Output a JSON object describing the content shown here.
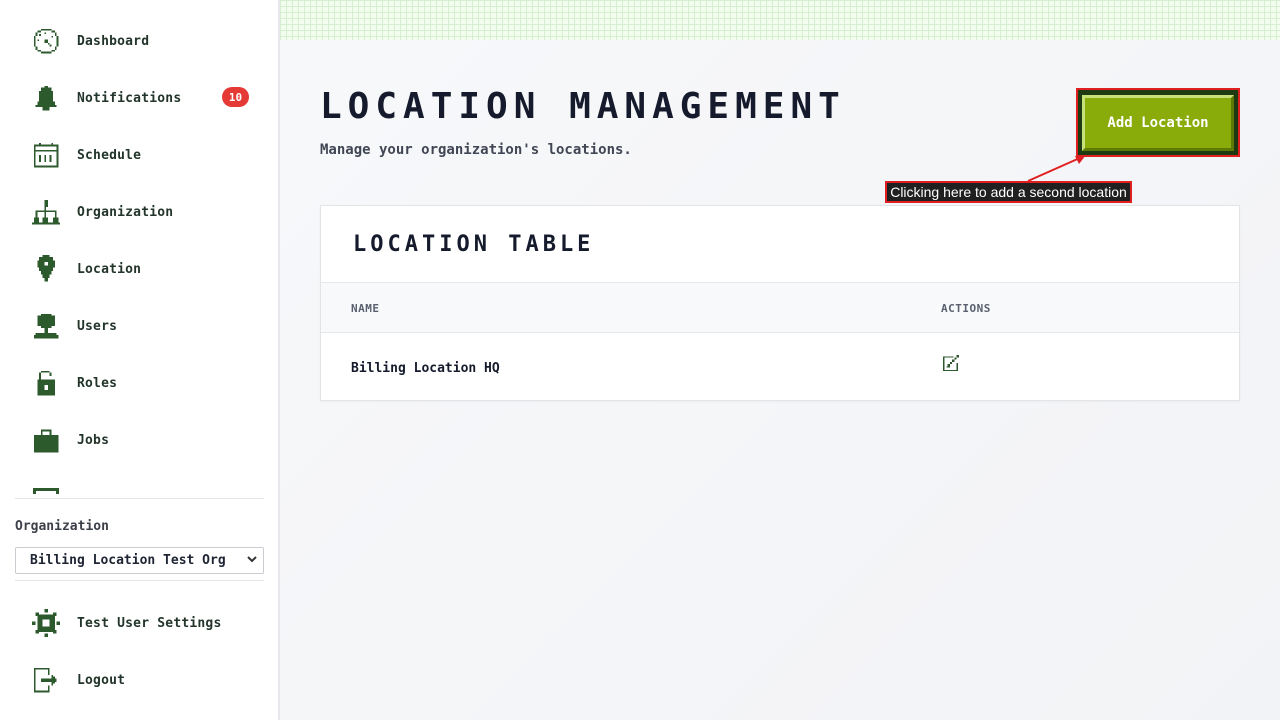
{
  "sidebar": {
    "nav": [
      {
        "label": "Dashboard",
        "icon": "dashboard-icon"
      },
      {
        "label": "Notifications",
        "icon": "bell-icon",
        "badge": "10"
      },
      {
        "label": "Schedule",
        "icon": "calendar-icon"
      },
      {
        "label": "Organization",
        "icon": "org-chart-icon"
      },
      {
        "label": "Location",
        "icon": "map-pin-icon"
      },
      {
        "label": "Users",
        "icon": "user-icon"
      },
      {
        "label": "Roles",
        "icon": "unlock-icon"
      },
      {
        "label": "Jobs",
        "icon": "briefcase-icon"
      }
    ],
    "org_label": "Organization",
    "org_select_value": "Billing Location Test Org",
    "settings_label": "Test User Settings",
    "logout_label": "Logout"
  },
  "main": {
    "title": "LOCATION MANAGEMENT",
    "subtitle": "Manage your organization's locations.",
    "add_button_label": "Add Location",
    "annotation": "Clicking here to add a second location"
  },
  "table": {
    "title": "LOCATION TABLE",
    "columns": [
      "NAME",
      "ACTIONS"
    ],
    "rows": [
      {
        "name": "Billing Location HQ",
        "action_icon": "edit-icon"
      }
    ]
  },
  "colors": {
    "sidebar_icon": "#2d5a2d",
    "accent_button": "#8aac0a",
    "badge": "#e53935",
    "annotation_border": "#e02020"
  }
}
